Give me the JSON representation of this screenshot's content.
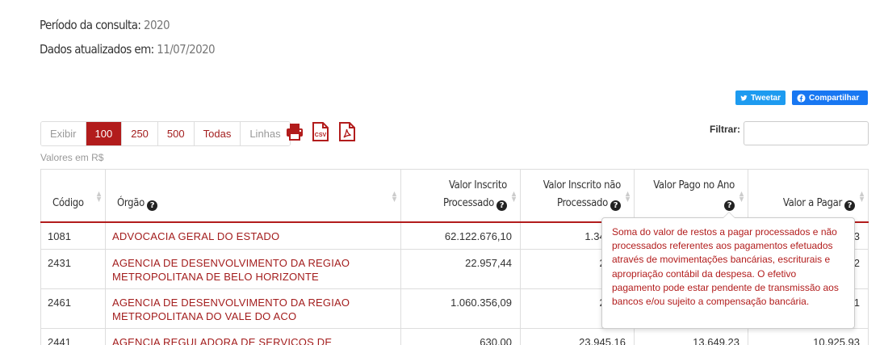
{
  "meta": {
    "period_label": "Período da consulta:",
    "period_value": "2020",
    "updated_label": "Dados atualizados em:",
    "updated_value": "11/07/2020"
  },
  "share": {
    "tweet": "Tweetar",
    "share": "Compartilhar",
    "tweet_color": "#1d9bf0",
    "share_color": "#1877f2"
  },
  "pager": {
    "show_label": "Exibir",
    "options": [
      "100",
      "250",
      "500",
      "Todas"
    ],
    "selected": "100",
    "rows_label": "Linhas"
  },
  "tools": {
    "print": "print-icon",
    "csv": "csv-icon",
    "pdf": "pdf-icon",
    "csv_text": "CSV"
  },
  "filter": {
    "label": "Filtrar:",
    "value": ""
  },
  "values_note": "Valores em R$",
  "table": {
    "columns": [
      {
        "label": "Código"
      },
      {
        "label": "Órgão"
      },
      {
        "line1": "Valor Inscrito",
        "line2": "Processado"
      },
      {
        "line1": "Valor Inscrito não",
        "line2": "Processado"
      },
      {
        "line1": "Valor Pago no Ano",
        "line2": ""
      },
      {
        "label": "Valor a Pagar"
      }
    ],
    "rows": [
      {
        "code": "1081",
        "org_line1": "ADVOCACIA GERAL DO ESTADO",
        "org_line2": "",
        "inscrito_proc": "62.122.676,10",
        "inscrito_nao_proc": "1.344.43",
        "pago": "",
        "a_pagar": "3"
      },
      {
        "code": "2431",
        "org_line1": "AGENCIA DE DESENVOLVIMENTO DA REGIAO",
        "org_line2": "METROPOLITANA DE BELO HORIZONTE",
        "inscrito_proc": "22.957,44",
        "inscrito_nao_proc": "22.35",
        "pago": "",
        "a_pagar": "2"
      },
      {
        "code": "2461",
        "org_line1": "AGENCIA DE DESENVOLVIMENTO DA REGIAO",
        "org_line2": "METROPOLITANA DO VALE DO ACO",
        "inscrito_proc": "1.060.356,09",
        "inscrito_nao_proc": "26.66",
        "pago": "",
        "a_pagar": "1"
      },
      {
        "code": "2441",
        "org_line1": "AGENCIA REGULADORA DE SERVICOS DE",
        "org_line2": "",
        "inscrito_proc": "630,00",
        "inscrito_nao_proc": "23.945,16",
        "pago": "13.649,23",
        "a_pagar": "10.925,93"
      }
    ]
  },
  "tooltip": {
    "text": "Soma do valor de restos a pagar processados e não processados referentes aos pagamentos efetuados através de movimentações bancárias, escriturais e apropriação contábil da despesa. O efetivo pagamento pode estar pendente de transmissão aos bancos e/ou sujeito a compensação bancária."
  },
  "colors": {
    "accent": "#b21c1c",
    "link": "#a31d1d"
  }
}
